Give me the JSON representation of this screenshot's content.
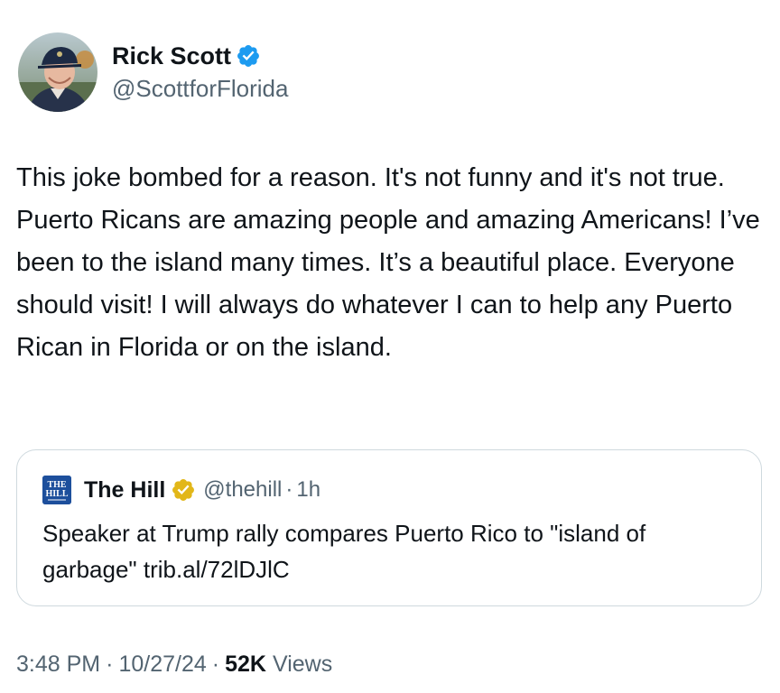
{
  "author": {
    "display_name": "Rick Scott",
    "handle": "@ScottforFlorida",
    "avatar_icon": "user-avatar-photo",
    "verified_icon": "verified-blue-badge-icon"
  },
  "tweet": {
    "text": "This joke bombed for a reason. It's not funny and it's not true. Puerto Ricans are amazing people and amazing Americans! I’ve been to the island many times. It’s a beautiful place. Everyone should visit! I will always do whatever I can to help any Puerto Rican in Florida or on the island."
  },
  "quote": {
    "logo_text_top": "THE",
    "logo_text_bottom": "HILL",
    "display_name": "The Hill",
    "verified_icon": "verified-gold-badge-icon",
    "handle": "@thehill",
    "separator": "·",
    "time": "1h",
    "text": "Speaker at Trump rally compares Puerto Rico to \"island of garbage\" trib.al/72lDJlC"
  },
  "footer": {
    "time": "3:48 PM",
    "separator": "·",
    "date": "10/27/24",
    "views_count": "52K",
    "views_label": "Views"
  },
  "colors": {
    "text_primary": "#0f1419",
    "text_secondary": "#536471",
    "verified_blue": "#1d9bf0",
    "verified_gold": "#e2b719",
    "border": "#cfd9de",
    "hill_blue": "#1d4f9c"
  }
}
